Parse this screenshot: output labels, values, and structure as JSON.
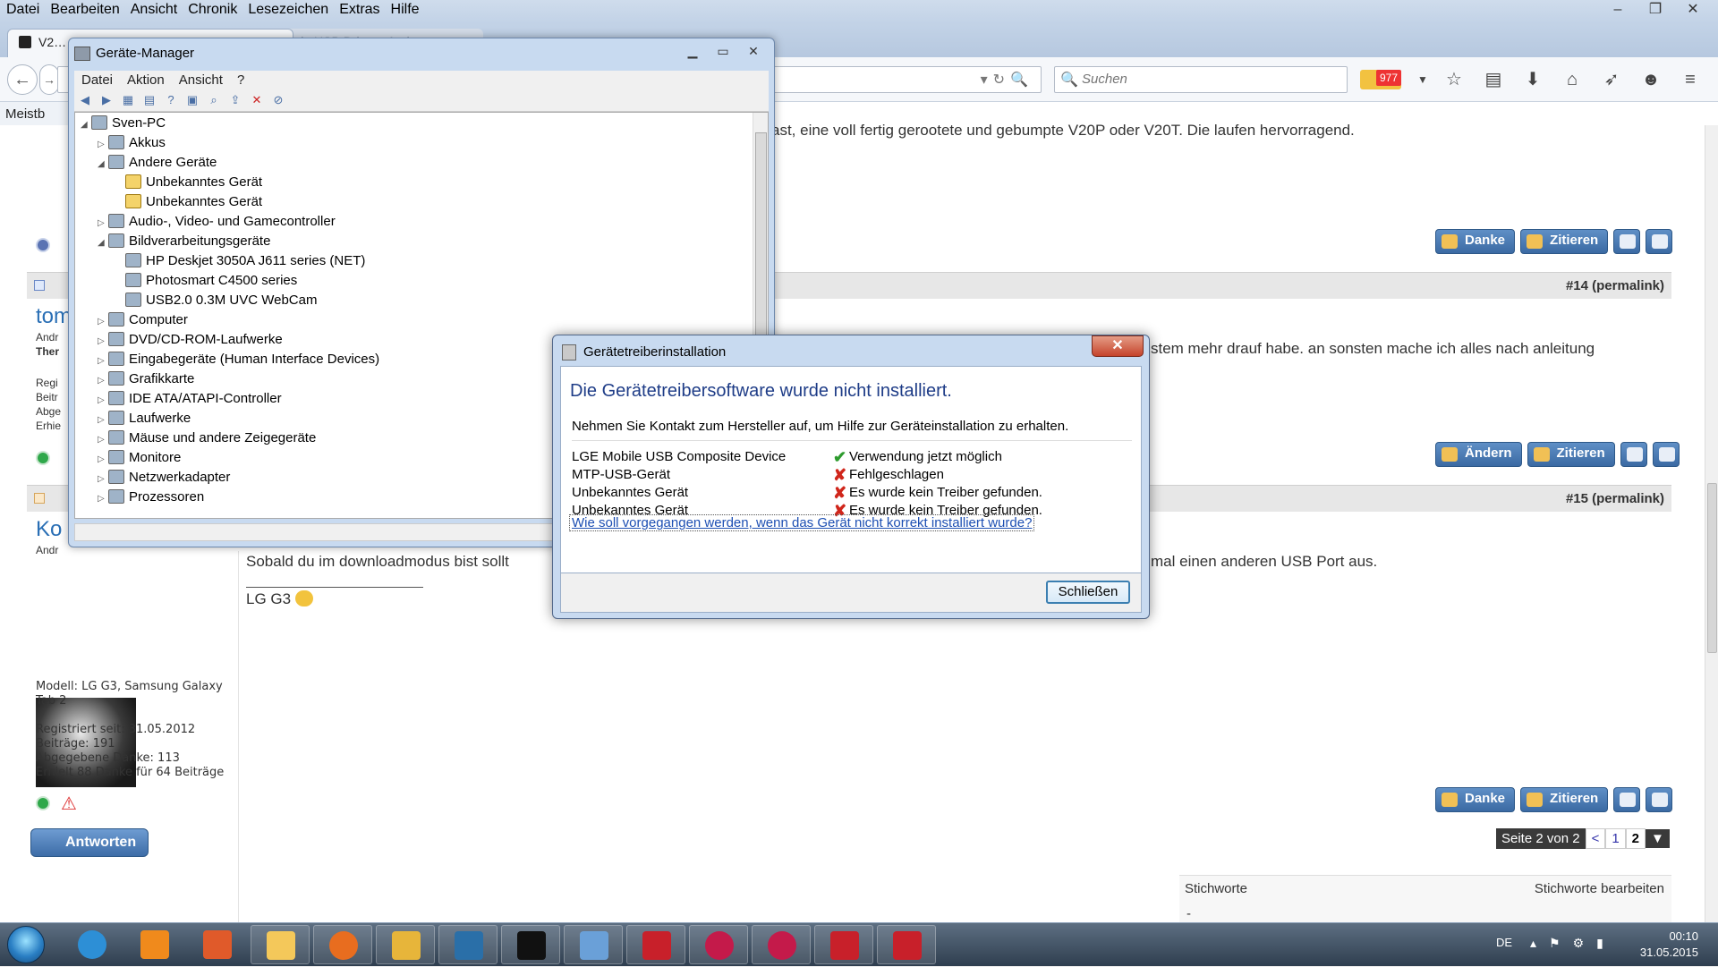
{
  "browser": {
    "menu": [
      "Datei",
      "Bearbeiten",
      "Ansicht",
      "Chronik",
      "Lesezeichen",
      "Extras",
      "Hilfe"
    ],
    "window_controls": [
      "–",
      "❐",
      "✕"
    ],
    "tabs": [
      {
        "label": "V2…",
        "active": true
      },
      {
        "label": "Google USB Driver - Andro…",
        "active": false
      }
    ],
    "search_placeholder": "Suchen",
    "mail_badge": "977",
    "bookmarks_label": "Meistb",
    "toolbar_icons": [
      "star-icon",
      "clipboard-icon",
      "download-icon",
      "home-icon",
      "send-icon",
      "chat-icon",
      "menu-icon"
    ]
  },
  "forum": {
    "post13_text": "ast, eine voll fertig gerootete und gebumpte V20P oder V20T. Die laufen hervorragend.",
    "post14": {
      "number": "#14 (permalink)",
      "user": "tom",
      "user_line1": "Andr",
      "user_line2": "Ther",
      "info_lines": [
        "Regi",
        "Beitr",
        "Abge",
        "Erhie"
      ],
      "text": "stem mehr drauf habe. an sonsten mache ich alles nach anleitung"
    },
    "post15": {
      "number": "#15 (permalink)",
      "user": "Ko",
      "user_sub": "Andr",
      "text_left": "Sobald du im downloadmodus bist sollt",
      "text_right": "mal einen anderen USB Port aus.",
      "signature": "LG G3",
      "user_info": [
        "Modell: LG G3, Samsung Galaxy",
        "Tab 2",
        "",
        "Registriert seit: 31.05.2012",
        "Beiträge: 191",
        "Abgegebene Danke: 113",
        "Erhielt 88 Danke für 64 Beiträge"
      ]
    },
    "buttons": {
      "danke": "Danke",
      "zitieren": "Zitieren",
      "aendern": "Ändern"
    },
    "reply_button": "Antworten",
    "pager": {
      "label": "Seite 2 von 2",
      "prev": "<",
      "pages": [
        "1",
        "2"
      ],
      "current": "2"
    },
    "tags": {
      "title": "Stichworte",
      "edit": "Stichworte bearbeiten",
      "value": "-"
    }
  },
  "device_manager": {
    "title": "Geräte-Manager",
    "menu": [
      "Datei",
      "Aktion",
      "Ansicht",
      "?"
    ],
    "tree": [
      {
        "label": "Sven-PC",
        "level": 0,
        "expand": "◢",
        "warn": false
      },
      {
        "label": "Akkus",
        "level": 1,
        "expand": "▷",
        "warn": false
      },
      {
        "label": "Andere Geräte",
        "level": 1,
        "expand": "◢",
        "warn": false
      },
      {
        "label": "Unbekanntes Gerät",
        "level": 2,
        "expand": "",
        "warn": true
      },
      {
        "label": "Unbekanntes Gerät",
        "level": 2,
        "expand": "",
        "warn": true
      },
      {
        "label": "Audio-, Video- und Gamecontroller",
        "level": 1,
        "expand": "▷",
        "warn": false
      },
      {
        "label": "Bildverarbeitungsgeräte",
        "level": 1,
        "expand": "◢",
        "warn": false
      },
      {
        "label": "HP Deskjet 3050A J611 series (NET)",
        "level": 2,
        "expand": "",
        "warn": false
      },
      {
        "label": "Photosmart C4500 series",
        "level": 2,
        "expand": "",
        "warn": false
      },
      {
        "label": "USB2.0 0.3M UVC WebCam",
        "level": 2,
        "expand": "",
        "warn": false
      },
      {
        "label": "Computer",
        "level": 1,
        "expand": "▷",
        "warn": false
      },
      {
        "label": "DVD/CD-ROM-Laufwerke",
        "level": 1,
        "expand": "▷",
        "warn": false
      },
      {
        "label": "Eingabegeräte (Human Interface Devices)",
        "level": 1,
        "expand": "▷",
        "warn": false
      },
      {
        "label": "Grafikkarte",
        "level": 1,
        "expand": "▷",
        "warn": false
      },
      {
        "label": "IDE ATA/ATAPI-Controller",
        "level": 1,
        "expand": "▷",
        "warn": false
      },
      {
        "label": "Laufwerke",
        "level": 1,
        "expand": "▷",
        "warn": false
      },
      {
        "label": "Mäuse und andere Zeigegeräte",
        "level": 1,
        "expand": "▷",
        "warn": false
      },
      {
        "label": "Monitore",
        "level": 1,
        "expand": "▷",
        "warn": false
      },
      {
        "label": "Netzwerkadapter",
        "level": 1,
        "expand": "▷",
        "warn": false
      },
      {
        "label": "Prozessoren",
        "level": 1,
        "expand": "▷",
        "warn": false
      }
    ]
  },
  "dialog": {
    "title": "Gerätetreiberinstallation",
    "close": "✕",
    "heading": "Die Gerätetreibersoftware wurde nicht installiert.",
    "subtitle": "Nehmen Sie Kontakt zum Hersteller auf, um Hilfe zur Geräteinstallation zu erhalten.",
    "devices": [
      {
        "name": "LGE Mobile USB Composite Device",
        "status": "Verwendung jetzt möglich",
        "ok": true
      },
      {
        "name": "MTP-USB-Gerät",
        "status": "Fehlgeschlagen",
        "ok": false
      },
      {
        "name": "Unbekanntes Gerät",
        "status": "Es wurde kein Treiber gefunden.",
        "ok": false
      },
      {
        "name": "Unbekanntes Gerät",
        "status": "Es wurde kein Treiber gefunden.",
        "ok": false
      }
    ],
    "link": "Wie soll vorgegangen werden, wenn das Gerät nicht korrekt installiert wurde?",
    "button": "Schließen"
  },
  "taskbar": {
    "apps": [
      {
        "name": "internet-explorer-icon",
        "color": "#2d8fd6"
      },
      {
        "name": "media-player-icon",
        "color": "#f08a1c"
      },
      {
        "name": "office-icon",
        "color": "#e05a2a"
      },
      {
        "name": "explorer-icon",
        "color": "#f4c85a"
      },
      {
        "name": "firefox-icon",
        "color": "#e86d1f"
      },
      {
        "name": "tools-icon",
        "color": "#e7b53a"
      },
      {
        "name": "device-icon",
        "color": "#2a6fa8"
      },
      {
        "name": "cmd-icon",
        "color": "#111111"
      },
      {
        "name": "control-panel-icon",
        "color": "#6aa0d8"
      },
      {
        "name": "toolbox-icon",
        "color": "#c8202a"
      },
      {
        "name": "lg-icon",
        "color": "#c41a4a"
      },
      {
        "name": "lg-icon-2",
        "color": "#c41a4a"
      },
      {
        "name": "toolbox-icon-2",
        "color": "#c8202a"
      },
      {
        "name": "toolbox-icon-3",
        "color": "#c8202a"
      }
    ],
    "lang": "DE",
    "time": "00:10",
    "date": "31.05.2015"
  }
}
